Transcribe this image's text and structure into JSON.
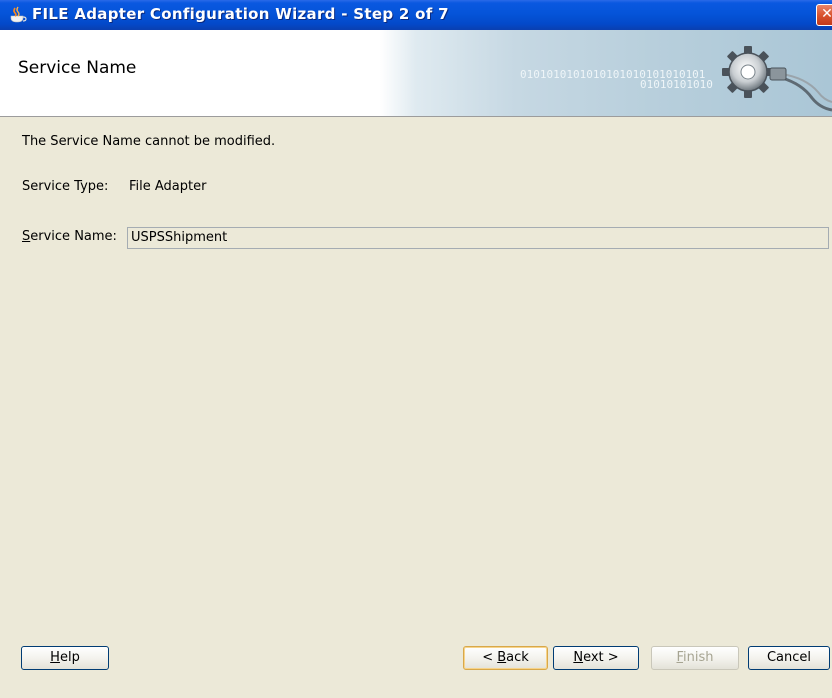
{
  "window": {
    "title": "FILE Adapter Configuration Wizard - Step 2 of 7",
    "icon": "oracle-cup-icon",
    "close_glyph": "✕"
  },
  "header": {
    "title": "Service Name",
    "banner_binary_line1": "0101010101010101010101010101",
    "banner_binary_line2": "01010101010",
    "banner_icon": "gear-plug-icon"
  },
  "content": {
    "info": "The Service Name cannot be modified.",
    "service_type_label": "Service Type:",
    "service_type_value": "File Adapter",
    "service_name_label_mnemonic": "S",
    "service_name_label_rest": "ervice Name:",
    "service_name_value": "USPSShipment"
  },
  "buttons": {
    "help_mnemonic": "H",
    "help_rest": "elp",
    "back_prefix": "< ",
    "back_mnemonic": "B",
    "back_rest": "ack",
    "next_mnemonic": "N",
    "next_rest": "ext >",
    "finish_mnemonic": "F",
    "finish_rest": "inish",
    "cancel": "Cancel"
  },
  "colors": {
    "titlebar": "#0554d9",
    "window_bg": "#ece9d8",
    "header_bg": "#ffffff",
    "disabled_text": "#a6a492"
  }
}
